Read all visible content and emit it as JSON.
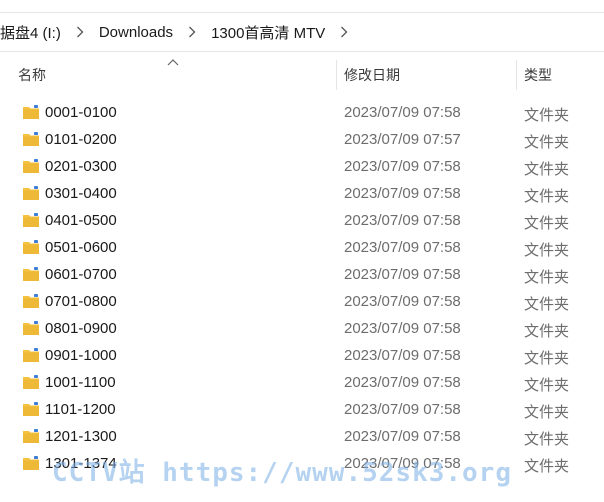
{
  "breadcrumb": {
    "items": [
      "据盘4 (I:)",
      "Downloads",
      "1300首高清 MTV"
    ]
  },
  "columns": {
    "name": "名称",
    "date": "修改日期",
    "type": "类型"
  },
  "files": [
    {
      "name": "0001-0100",
      "date": "2023/07/09 07:58",
      "type": "文件夹"
    },
    {
      "name": "0101-0200",
      "date": "2023/07/09 07:57",
      "type": "文件夹"
    },
    {
      "name": "0201-0300",
      "date": "2023/07/09 07:58",
      "type": "文件夹"
    },
    {
      "name": "0301-0400",
      "date": "2023/07/09 07:58",
      "type": "文件夹"
    },
    {
      "name": "0401-0500",
      "date": "2023/07/09 07:58",
      "type": "文件夹"
    },
    {
      "name": "0501-0600",
      "date": "2023/07/09 07:58",
      "type": "文件夹"
    },
    {
      "name": "0601-0700",
      "date": "2023/07/09 07:58",
      "type": "文件夹"
    },
    {
      "name": "0701-0800",
      "date": "2023/07/09 07:58",
      "type": "文件夹"
    },
    {
      "name": "0801-0900",
      "date": "2023/07/09 07:58",
      "type": "文件夹"
    },
    {
      "name": "0901-1000",
      "date": "2023/07/09 07:58",
      "type": "文件夹"
    },
    {
      "name": "1001-1100",
      "date": "2023/07/09 07:58",
      "type": "文件夹"
    },
    {
      "name": "1101-1200",
      "date": "2023/07/09 07:58",
      "type": "文件夹"
    },
    {
      "name": "1201-1300",
      "date": "2023/07/09 07:58",
      "type": "文件夹"
    },
    {
      "name": "1301-1374",
      "date": "2023/07/09 07:58",
      "type": "文件夹"
    }
  ],
  "watermark": "CCTV站 https://www.52sk3.org",
  "icons": {
    "folder": "folder-icon",
    "chevron": "chevron-right-icon",
    "sort": "sort-up-icon"
  },
  "colors": {
    "folder": "#f5c242",
    "folder_dark": "#e0a81f",
    "text_secondary": "#6d6d6d"
  }
}
